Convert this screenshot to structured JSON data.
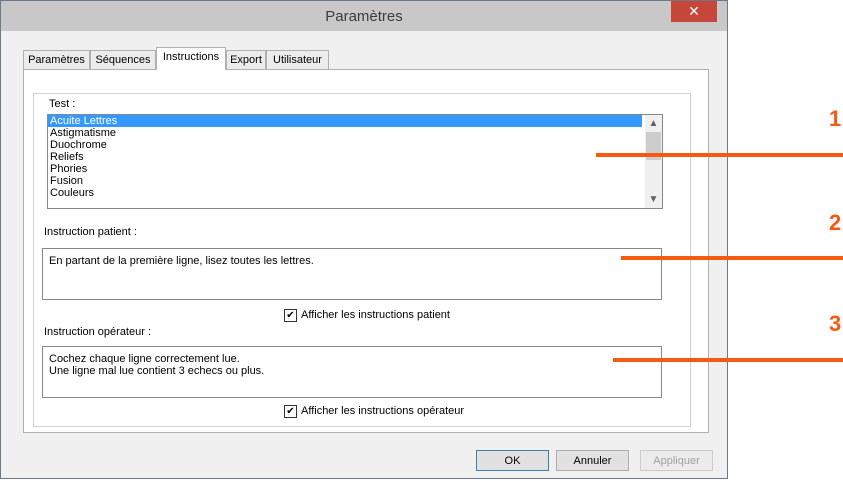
{
  "window": {
    "title": "Paramètres",
    "close_label": "✕"
  },
  "tabs": [
    "Paramètres",
    "Séquences",
    "Instructions",
    "Export",
    "Utilisateur"
  ],
  "active_tab": "Instructions",
  "test": {
    "label": "Test :",
    "items": [
      "Acuite Lettres",
      "Astigmatisme",
      "Duochrome",
      "Reliefs",
      "Phories",
      "Fusion",
      "Couleurs"
    ],
    "selected": "Acuite Lettres"
  },
  "patient": {
    "label": "Instruction patient :",
    "text": "En partant de la première ligne, lisez toutes les lettres.",
    "checkbox_label": "Afficher les instructions patient",
    "checked": true
  },
  "operator": {
    "label": "Instruction opérateur :",
    "text": "Cochez chaque ligne correctement lue.\nUne ligne mal lue contient 3 echecs ou plus.",
    "checkbox_label": "Afficher les instructions opérateur",
    "checked": true
  },
  "buttons": {
    "ok": "OK",
    "cancel": "Annuler",
    "apply": "Appliquer"
  },
  "callouts": [
    "1",
    "2",
    "3"
  ],
  "colors": {
    "callout": "#f45a11",
    "selection": "#3399ff",
    "close_button": "#c7463a"
  }
}
